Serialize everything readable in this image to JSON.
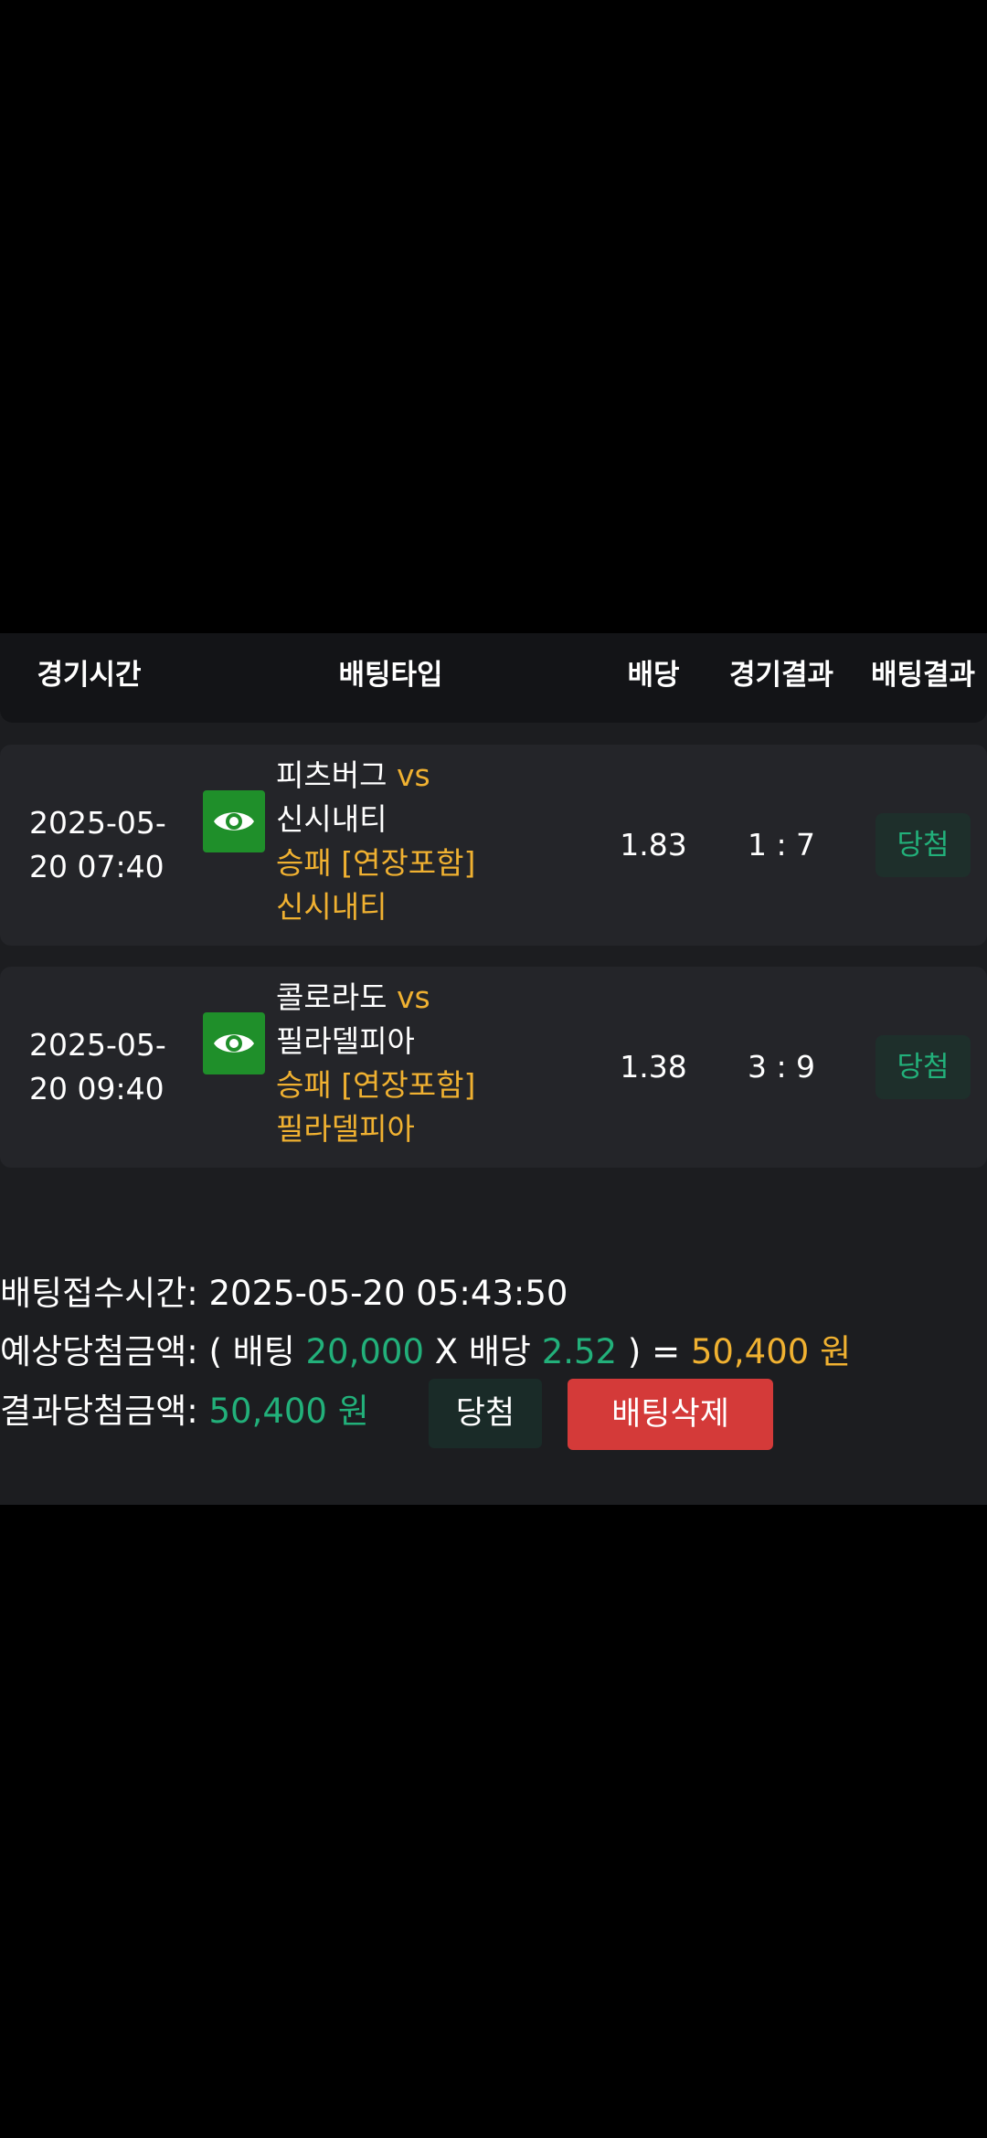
{
  "table": {
    "headers": {
      "time": "경기시간",
      "type": "배팅타입",
      "odds": "배당",
      "game_result": "경기결과",
      "bet_result": "배팅결과"
    },
    "rows": [
      {
        "date_line1": "2025-05-",
        "date_line2": "20 07:40",
        "home": "피츠버그",
        "vs": "vs",
        "away": "신시내티",
        "bet_type": "승패 [연장포함]",
        "pick": "신시내티",
        "odds": "1.83",
        "score": "1 : 7",
        "result": "당첨",
        "icon": "eye-icon"
      },
      {
        "date_line1": "2025-05-",
        "date_line2": "20 09:40",
        "home": "콜로라도",
        "vs": "vs",
        "away": "필라델피아",
        "bet_type": "승패 [연장포함]",
        "pick": "필라델피아",
        "odds": "1.38",
        "score": "3 : 9",
        "result": "당첨",
        "icon": "eye-icon"
      }
    ]
  },
  "summary": {
    "received_label": "배팅접수시간:",
    "received_value": "2025-05-20 05:43:50",
    "expected_label": "예상당첨금액: ( 배팅",
    "bet_amount": "20,000",
    "times_label": "X 배당",
    "total_odds": "2.52",
    "equals_label": ") =",
    "expected_amount": "50,400 원",
    "result_label": "결과당첨금액:",
    "result_amount": "50,400 원"
  },
  "buttons": {
    "win_label": "당첨",
    "delete_label": "배팅삭제"
  },
  "colors": {
    "accent_green": "#22b07a",
    "accent_orange": "#f0b131",
    "delete_red": "#d43a39",
    "eye_green": "#1f8f2a"
  }
}
